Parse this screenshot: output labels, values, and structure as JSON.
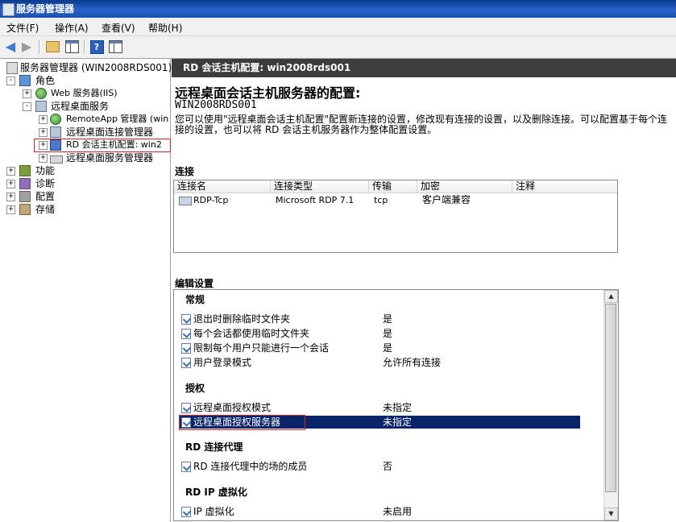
{
  "window": {
    "title": "服务器管理器"
  },
  "menu": [
    "文件(F)",
    "操作(A)",
    "查看(V)",
    "帮助(H)"
  ],
  "tree": {
    "root": "服务器管理器 (WIN2008RDS001)",
    "roles": "角色",
    "web": "Web 服务器(IIS)",
    "rds": "远程桌面服务",
    "remoteapp": "RemoteApp 管理器 (win",
    "rdconn": "远程桌面连接管理器",
    "rdhost": "RD 会话主机配置: win2",
    "rdsmgr": "远程桌面服务管理器",
    "features": "功能",
    "diagnostics": "诊断",
    "config": "配置",
    "storage": "存储"
  },
  "panel": {
    "header": "RD 会话主机配置: win2008rds001",
    "title": "远程桌面会话主机服务器的配置:",
    "server": "WIN2008RDS001",
    "desc_line1": "您可以使用\"远程桌面会话主机配置\"配置新连接的设置，修改现有连接的设置，以及删除连接。可以配置基于每个连",
    "desc_line2": "接的设置，也可以将 RD 会话主机服务器作为整体配置设置。",
    "connections_header": "连接",
    "columns": [
      "连接名",
      "连接类型",
      "传输",
      "加密",
      "注释"
    ],
    "connections": [
      {
        "name": "RDP-Tcp",
        "type": "Microsoft RDP 7.1",
        "transport": "tcp",
        "encryption": "客户端兼容",
        "comment": ""
      }
    ],
    "edit_header": "编辑设置",
    "groups": {
      "general": {
        "title": "常规",
        "rows": [
          {
            "label": "退出时删除临时文件夹",
            "value": "是"
          },
          {
            "label": "每个会话都使用临时文件夹",
            "value": "是"
          },
          {
            "label": "限制每个用户只能进行一个会话",
            "value": "是"
          },
          {
            "label": "用户登录模式",
            "value": "允许所有连接"
          }
        ]
      },
      "licensing": {
        "title": "授权",
        "rows": [
          {
            "label": "远程桌面授权模式",
            "value": "未指定"
          },
          {
            "label": "远程桌面授权服务器",
            "value": "未指定"
          }
        ]
      },
      "broker": {
        "title": "RD 连接代理",
        "rows": [
          {
            "label": "RD 连接代理中的场的成员",
            "value": "否"
          }
        ]
      },
      "ipvirt": {
        "title": "RD IP 虚拟化",
        "rows": [
          {
            "label": "IP 虚拟化",
            "value": "未启用"
          }
        ]
      }
    }
  },
  "colors": {
    "selection": "#0a246a",
    "highlight_box": "#e2231a",
    "header_bar": "#3c3c3c"
  }
}
